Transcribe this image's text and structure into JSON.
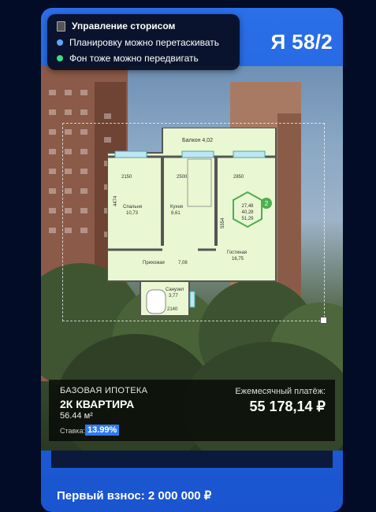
{
  "story": {
    "title": "Я 58/2"
  },
  "tooltip": {
    "header": "Управление сторисом",
    "hint_drag_plan": "Планировку можно перетаскивать",
    "hint_drag_bg": "Фон тоже можно передвигать",
    "dot_blue": "#5aa7ff",
    "dot_green": "#3ddc84"
  },
  "floorplan": {
    "balcony": "Балкон  4,02",
    "bedroom": "Спальня",
    "bedroom_area": "10,73",
    "kitchen": "Кухня",
    "kitchen_area": "8,61",
    "living": "Гостиная",
    "living_area": "16,75",
    "hall": "Прихожая",
    "hall_area": "7,08",
    "bath": "Санузел",
    "bath_area": "3,77",
    "dim_2150": "2150",
    "dim_2500": "2500",
    "dim_2850": "2850",
    "dim_4474": "4474",
    "dim_5554": "5554",
    "dim_2140": "2140",
    "badge_number": "2",
    "hex_area1": "27,48",
    "hex_area2": "40,28",
    "hex_area3": "51,29"
  },
  "offer": {
    "label": "БАЗОВАЯ ИПОТЕКА",
    "type": "2К КВАРТИРА",
    "area": "56.44 м²",
    "rate_label": "Ставка:",
    "rate": "13.99%",
    "monthly_label": "Ежемесячный платёж:",
    "monthly": "55 178,14 ₽"
  },
  "first_payment": "Первый взнос: 2 000 000 ₽"
}
